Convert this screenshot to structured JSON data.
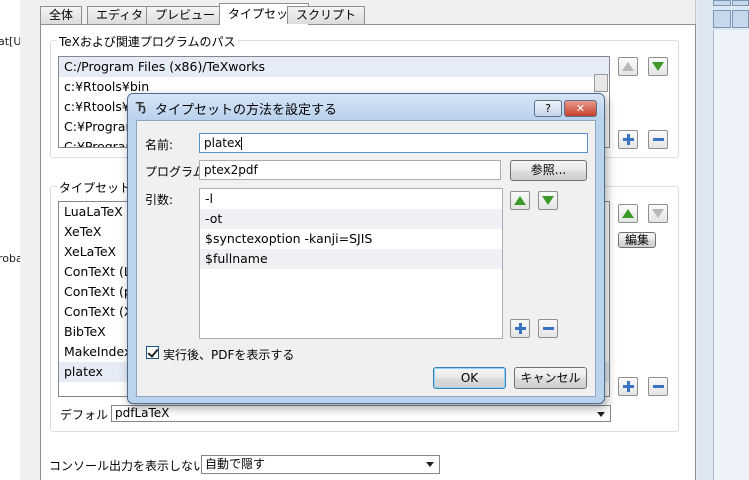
{
  "left_fragments": [
    "at[U]",
    "roba"
  ],
  "tabs": [
    "全体",
    "エディタ",
    "プレビュー",
    "タイプセット",
    "スクリプト"
  ],
  "active_tab": 3,
  "paths_group": {
    "title": "TeXおよび関連プログラムのパス",
    "items": [
      "C:/Program Files (x86)/TeXworks",
      "c:¥Rtools¥bin",
      "c:¥Rtools¥",
      "C:¥Program",
      "C:¥Program"
    ]
  },
  "typeset_group": {
    "title": "タイプセットの方",
    "items": [
      "LuaLaTeX",
      "XeTeX",
      "XeLaTeX",
      "ConTeXt (L",
      "ConTeXt (p",
      "ConTeXt (X",
      "BibTeX",
      "MakeIndex",
      "platex"
    ],
    "edit_label": "編集",
    "default_label": "デフォルト:",
    "default_value": "pdfLaTeX"
  },
  "console": {
    "label": "コンソール出力を表示しない",
    "value": "自動で隠す"
  },
  "dialog": {
    "title": "タイプセットの方法を設定する",
    "help_label": "?",
    "name_label": "名前:",
    "name_value": "platex",
    "program_label": "プログラム:",
    "program_value": "ptex2pdf",
    "browse_label": "参照...",
    "args_label": "引数:",
    "args": [
      "-l",
      "-ot",
      "$synctexoption -kanji=SJIS",
      "$fullname"
    ],
    "checkbox_label": "実行後、PDFを表示する",
    "ok_label": "OK",
    "cancel_label": "キャンセル"
  }
}
